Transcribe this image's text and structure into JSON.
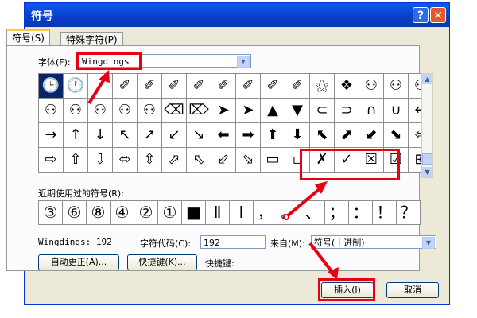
{
  "window": {
    "title": "符号",
    "help_label": "?",
    "close_label": "✕"
  },
  "tabs": [
    {
      "label": "符号(S)"
    },
    {
      "label": "特殊字符(P)"
    }
  ],
  "font": {
    "label": "字体(F):",
    "value": "Wingdings"
  },
  "grid": [
    [
      "🕒",
      "🕐",
      "",
      "✐",
      "✐",
      "✐",
      "✐",
      "✐",
      "✐",
      "✐",
      "✐",
      "⚝",
      "❖",
      "⚇",
      "⚇",
      "⚇"
    ],
    [
      "⚇",
      "⚇",
      "⚇",
      "⚇",
      "⚇",
      "⌫",
      "⌦",
      "➤",
      "➤",
      "▲",
      "▼",
      "⊂",
      "⊃",
      "∩",
      "∪",
      "←"
    ],
    [
      "→",
      "↑",
      "↓",
      "↖",
      "↗",
      "↙",
      "↘",
      "⬅",
      "➡",
      "⬆",
      "⬇",
      "⬉",
      "⬈",
      "⬋",
      "⬊",
      "⇦"
    ],
    [
      "⇨",
      "⇧",
      "⇩",
      "⬄",
      "⇳",
      "⬀",
      "⬁",
      "⬃",
      "⬂",
      "▭",
      "▫",
      "✗",
      "✓",
      "☒",
      "☑",
      "⊞"
    ]
  ],
  "recent": {
    "label": "近期使用过的符号(R):",
    "symbols": [
      "③",
      "⑥",
      "⑧",
      "④",
      "②",
      "①",
      "■",
      "Ⅱ",
      "Ⅰ",
      "，",
      "。",
      "、",
      "；",
      "：",
      "！",
      "？"
    ]
  },
  "info": {
    "font_code_text": "Wingdings: 192",
    "char_code_label": "字符代码(C):",
    "char_code_value": "192",
    "from_label": "来自(M):",
    "from_value": "符号(十进制)"
  },
  "buttons": {
    "autocorrect": "自动更正(A)...",
    "shortcut_key": "快捷键(K)...",
    "shortcut_label": "快捷键:",
    "insert": "插入(I)",
    "cancel": "取消"
  }
}
